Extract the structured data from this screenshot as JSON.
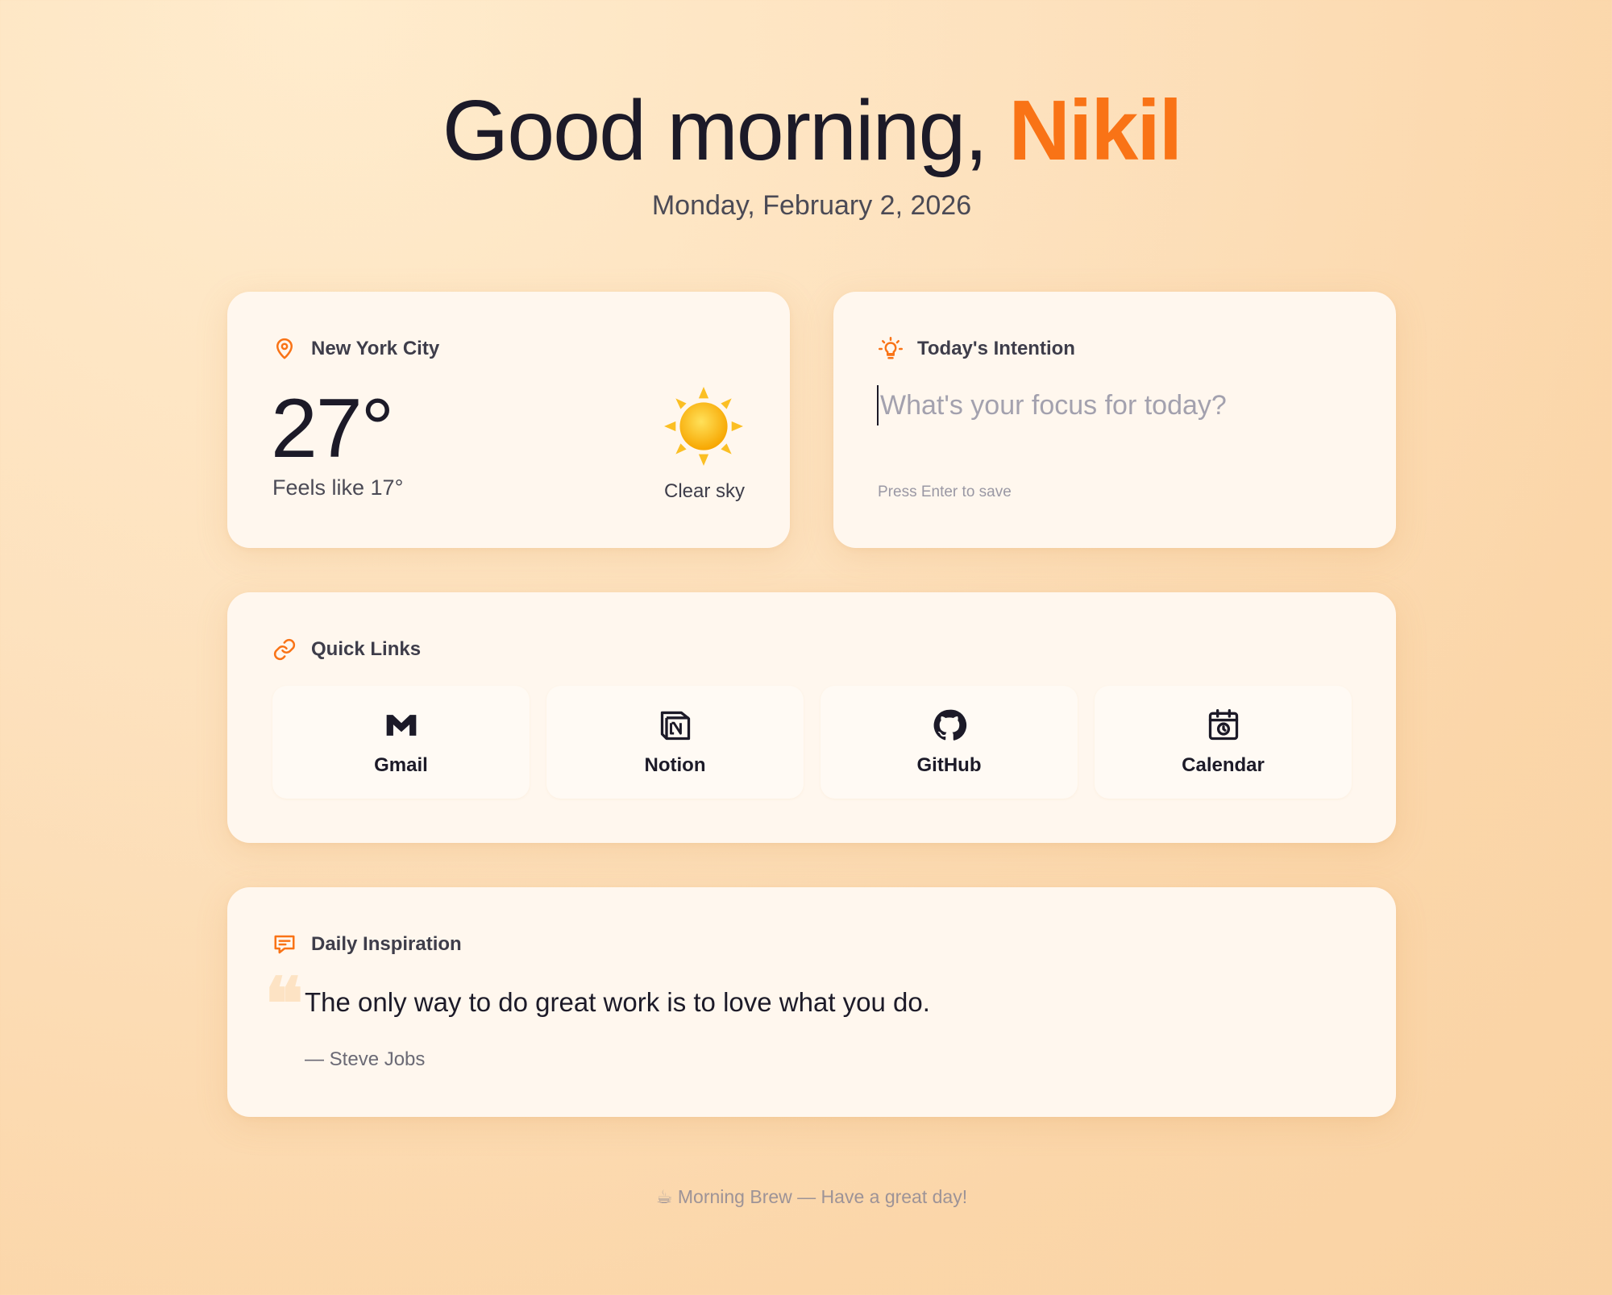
{
  "greeting": {
    "prefix": "Good morning,",
    "name": "Nikil"
  },
  "date": "Monday, February 2, 2026",
  "weather": {
    "location": "New York City",
    "temperature": "27°",
    "feels_like": "Feels like 17°",
    "condition": "Clear sky",
    "icon": "sun-icon"
  },
  "intention": {
    "title": "Today's Intention",
    "placeholder": "What's your focus for today?",
    "value": "",
    "hint": "Press Enter to save"
  },
  "quick_links": {
    "title": "Quick Links",
    "items": [
      {
        "label": "Gmail",
        "icon": "gmail-icon"
      },
      {
        "label": "Notion",
        "icon": "notion-icon"
      },
      {
        "label": "GitHub",
        "icon": "github-icon"
      },
      {
        "label": "Calendar",
        "icon": "calendar-icon"
      }
    ]
  },
  "inspiration": {
    "title": "Daily Inspiration",
    "quote": "The only way to do great work is to love what you do.",
    "author": "— Steve Jobs"
  },
  "footer": "☕ Morning Brew — Have a great day!",
  "colors": {
    "accent": "#f97316",
    "text": "#1c1a28",
    "card": "#fff7ee"
  }
}
